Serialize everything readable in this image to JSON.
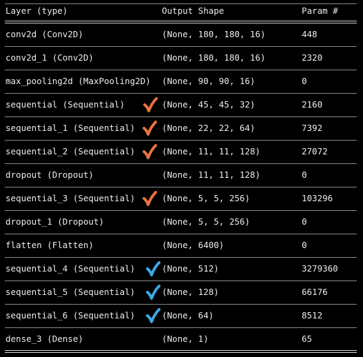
{
  "header": {
    "layer": "Layer (type)",
    "output": "Output Shape",
    "params": "Param #"
  },
  "rows": [
    {
      "layer": "conv2d (Conv2D)",
      "output": "(None, 180, 180, 16)",
      "params": "448"
    },
    {
      "layer": "conv2d_1 (Conv2D)",
      "output": "(None, 180, 180, 16)",
      "params": "2320"
    },
    {
      "layer": "max_pooling2d (MaxPooling2D)",
      "output": "(None, 90, 90, 16)",
      "params": "0"
    },
    {
      "layer": "sequential (Sequential)",
      "output": "(None, 45, 45, 32)",
      "params": "2160",
      "check": "orange"
    },
    {
      "layer": "sequential_1 (Sequential)",
      "output": "(None, 22, 22, 64)",
      "params": "7392",
      "check": "orange"
    },
    {
      "layer": "sequential_2 (Sequential)",
      "output": "(None, 11, 11, 128)",
      "params": "27072",
      "check": "orange"
    },
    {
      "layer": "dropout (Dropout)",
      "output": "(None, 11, 11, 128)",
      "params": "0"
    },
    {
      "layer": "sequential_3 (Sequential)",
      "output": "(None, 5, 5, 256)",
      "params": "103296",
      "check": "orange"
    },
    {
      "layer": "dropout_1 (Dropout)",
      "output": "(None, 5, 5, 256)",
      "params": "0"
    },
    {
      "layer": "flatten (Flatten)",
      "output": "(None, 6400)",
      "params": "0"
    },
    {
      "layer": "sequential_4 (Sequential)",
      "output": "(None, 512)",
      "params": "3279360",
      "check": "blue"
    },
    {
      "layer": "sequential_5 (Sequential)",
      "output": "(None, 128)",
      "params": "66176",
      "check": "blue"
    },
    {
      "layer": "sequential_6 (Sequential)",
      "output": "(None, 64)",
      "params": "8512",
      "check": "blue"
    },
    {
      "layer": "dense_3 (Dense)",
      "output": "(None, 1)",
      "params": "65"
    }
  ],
  "colors": {
    "background": "#000000",
    "text": "#ededed",
    "orange_check": "#e8743b",
    "blue_check": "#3ea8e5"
  },
  "icons": {
    "orange": "checkmark-icon",
    "blue": "checkmark-icon"
  }
}
